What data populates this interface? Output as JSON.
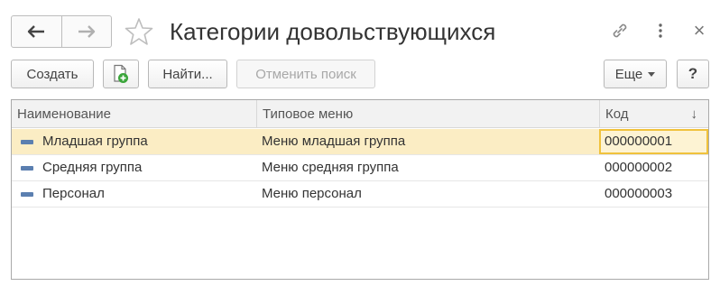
{
  "window": {
    "title": "Категории довольствующихся",
    "nav": {
      "back_icon": "arrow-left-icon",
      "forward_icon": "arrow-right-icon"
    },
    "favorite_icon": "star-icon",
    "link_icon": "link-icon",
    "more_icon": "vertical-dots-icon",
    "close_label": "×"
  },
  "toolbar": {
    "create_label": "Создать",
    "copy_icon": "add-document-icon",
    "find_label": "Найти...",
    "cancel_search_label": "Отменить поиск",
    "more_label": "Еще",
    "help_label": "?"
  },
  "table": {
    "columns": [
      "Наименование",
      "Типовое меню",
      "Код"
    ],
    "sort_indicator": "↓",
    "rows": [
      {
        "name": "Младшая группа",
        "menu": "Меню младшая группа",
        "code": "000000001",
        "selected": true
      },
      {
        "name": "Средняя группа",
        "menu": "Меню средняя группа",
        "code": "000000002",
        "selected": false
      },
      {
        "name": "Персонал",
        "menu": "Меню персонал",
        "code": "000000003",
        "selected": false
      }
    ]
  },
  "colors": {
    "selection": "#fbedc4",
    "focus_border": "#f0c23c",
    "row_icon": "#5b7fb0",
    "accent_green": "#3aa53a"
  }
}
